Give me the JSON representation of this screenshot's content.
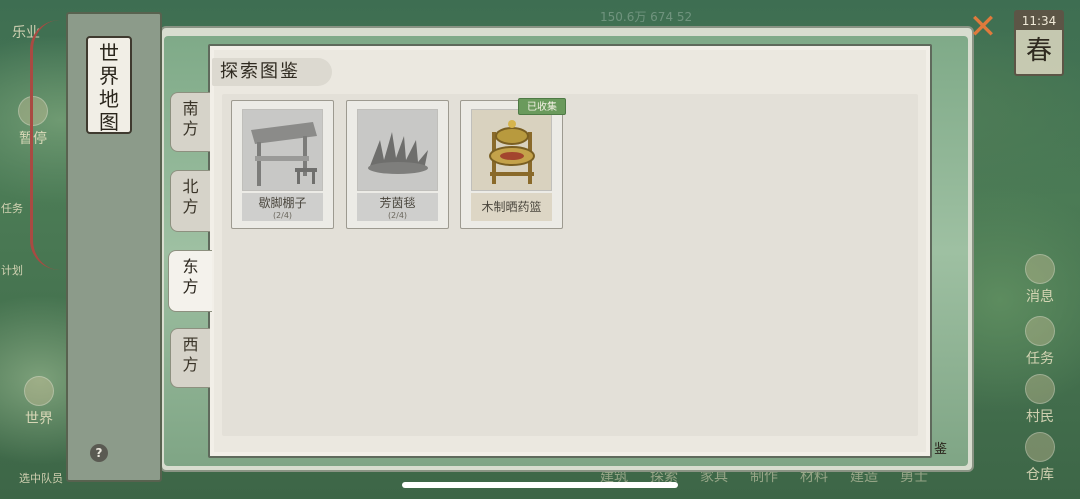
{
  "background": {
    "topbar": "150.6万   674   52",
    "left_items": [
      {
        "label": "乐业"
      },
      {
        "label": "暂停"
      },
      {
        "label": "任务"
      },
      {
        "label": "计划"
      },
      {
        "label": "世界"
      },
      {
        "label": "选中队员"
      }
    ],
    "right_items": [
      {
        "label": "消息"
      },
      {
        "label": "任务"
      },
      {
        "label": "村民"
      },
      {
        "label": "仓库"
      }
    ],
    "bottom_tabs": [
      "建筑",
      "探索",
      "家具",
      "制作",
      "材料",
      "建造",
      "勇士"
    ],
    "corner_text": "鉴"
  },
  "season": {
    "time": "11:34",
    "name": "春"
  },
  "scroll": {
    "label": "世\n界\n地\n图"
  },
  "window": {
    "title": "探索图鉴"
  },
  "tabs": [
    {
      "label": "南\n方",
      "active": false
    },
    {
      "label": "北\n方",
      "active": false
    },
    {
      "label": "东\n方",
      "active": true
    },
    {
      "label": "西\n方",
      "active": false
    }
  ],
  "cards": [
    {
      "name": "歇脚棚子",
      "progress": "(2/4)",
      "collected": false,
      "icon": "shed-icon"
    },
    {
      "name": "芳茵毯",
      "progress": "(2/4)",
      "collected": false,
      "icon": "grass-rug-icon"
    },
    {
      "name": "木制晒药篮",
      "progress": "",
      "collected": true,
      "badge": "已收集",
      "icon": "herb-basket-icon"
    }
  ],
  "colors": {
    "accent_close": "#e07a3c",
    "badge_green": "#6a9a5c",
    "paper": "#ebe8e0"
  }
}
